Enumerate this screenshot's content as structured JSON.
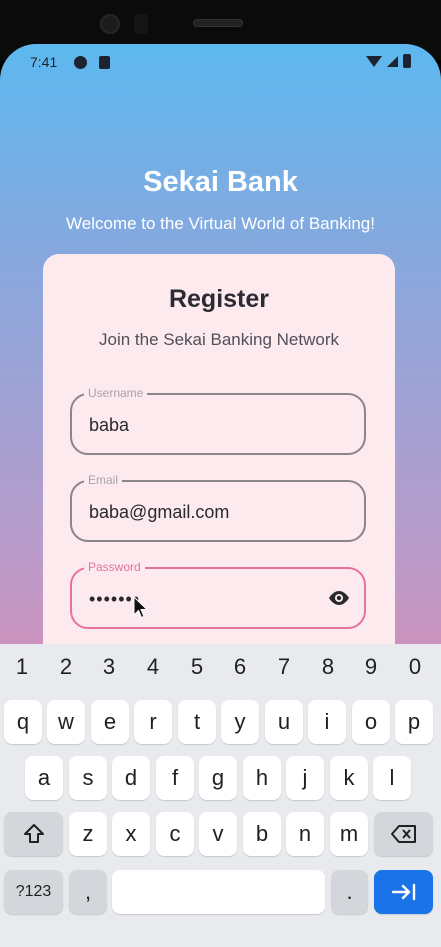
{
  "status_bar": {
    "time": "7:41",
    "left_icons": [
      "app-icon",
      "sim-icon"
    ],
    "right_icons": [
      "wifi-icon",
      "signal-icon",
      "battery-icon"
    ]
  },
  "header": {
    "title": "Sekai Bank",
    "subtitle": "Welcome to the Virtual World of Banking!"
  },
  "card": {
    "title": "Register",
    "subtitle": "Join the Sekai Banking Network",
    "fields": [
      {
        "label": "Username",
        "value": "baba"
      },
      {
        "label": "Email",
        "value": "baba@gmail.com"
      },
      {
        "label": "Password",
        "value": "•••••••"
      }
    ]
  },
  "keyboard": {
    "numbers": [
      "1",
      "2",
      "3",
      "4",
      "5",
      "6",
      "7",
      "8",
      "9",
      "0"
    ],
    "row1": [
      "q",
      "w",
      "e",
      "r",
      "t",
      "y",
      "u",
      "i",
      "o",
      "p"
    ],
    "row2": [
      "a",
      "s",
      "d",
      "f",
      "g",
      "h",
      "j",
      "k",
      "l"
    ],
    "row3": [
      "z",
      "x",
      "c",
      "v",
      "b",
      "n",
      "m"
    ],
    "symbols_label": "?123",
    "comma": ",",
    "period": "."
  },
  "colors": {
    "accent": "#e8729a",
    "card_bg": "#fdeaef",
    "action_key": "#1a73e8"
  }
}
